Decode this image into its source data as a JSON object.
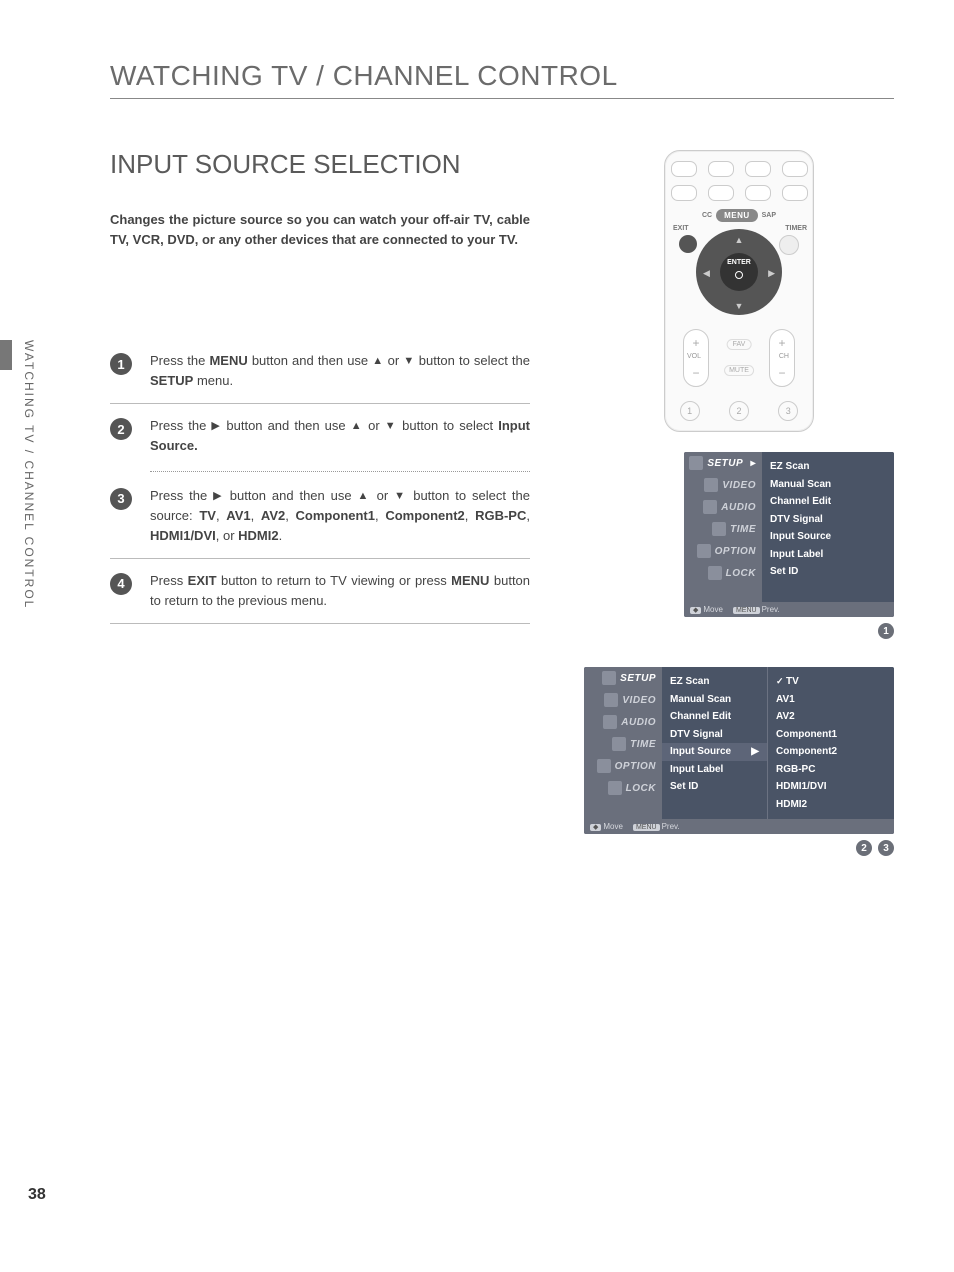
{
  "chapter_title": "WATCHING TV / CHANNEL CONTROL",
  "section_title": "INPUT SOURCE SELECTION",
  "lead": "Changes the picture source so you can watch your off-air TV, cable TV, VCR, DVD, or any other devices that are connected to your TV.",
  "side_tab": "WATCHING TV / CHANNEL CONTROL",
  "page_number": "38",
  "steps": {
    "s1_a": "Press the ",
    "s1_b": "MENU",
    "s1_c": " button and then use ",
    "s1_d": " or ",
    "s1_e": " button to select the ",
    "s1_f": "SETUP",
    "s1_g": " menu.",
    "s2_a": "Press the ",
    "s2_b": " button and then use ",
    "s2_c": " or ",
    "s2_d": " button to select ",
    "s2_e": "Input Source.",
    "s3_a": "Press the ",
    "s3_b": " button and then use ",
    "s3_c": " or ",
    "s3_d": " button to select the source: ",
    "s3_e": "TV",
    "s3_f": "AV1",
    "s3_g": "AV2",
    "s3_h": "Component1",
    "s3_i": "Component2",
    "s3_j": "RGB-PC",
    "s3_k": "HDMI1/DVI",
    "s3_l": "HDMI2",
    "s4_a": "Press ",
    "s4_b": "EXIT",
    "s4_c": " button to return to TV viewing or press ",
    "s4_d": "MENU",
    "s4_e": " button to return to the previous menu."
  },
  "remote": {
    "cc": "CC",
    "menu": "MENU",
    "sap": "SAP",
    "exit": "EXIT",
    "timer": "TIMER",
    "enter": "ENTER",
    "vol": "VOL",
    "ch": "CH",
    "fav": "FAV",
    "mute": "MUTE",
    "n1": "1",
    "n2": "2",
    "n3": "3"
  },
  "osd_nav": {
    "setup": "SETUP",
    "video": "VIDEO",
    "audio": "AUDIO",
    "time": "TIME",
    "option": "OPTION",
    "lock": "LOCK"
  },
  "osd_setup_items": {
    "ez": "EZ Scan",
    "ms": "Manual Scan",
    "ce": "Channel Edit",
    "dtv": "DTV Signal",
    "is": "Input Source",
    "il": "Input Label",
    "sid": "Set ID"
  },
  "osd_sources": {
    "tv": "TV",
    "av1": "AV1",
    "av2": "AV2",
    "c1": "Component1",
    "c2": "Component2",
    "rgb": "RGB-PC",
    "h1": "HDMI1/DVI",
    "h2": "HDMI2"
  },
  "osd_footer": {
    "move": "Move",
    "prev": "Prev."
  },
  "badges": {
    "b1": "1",
    "b2": "2",
    "b3": "3"
  },
  "arrow_right": "▶"
}
